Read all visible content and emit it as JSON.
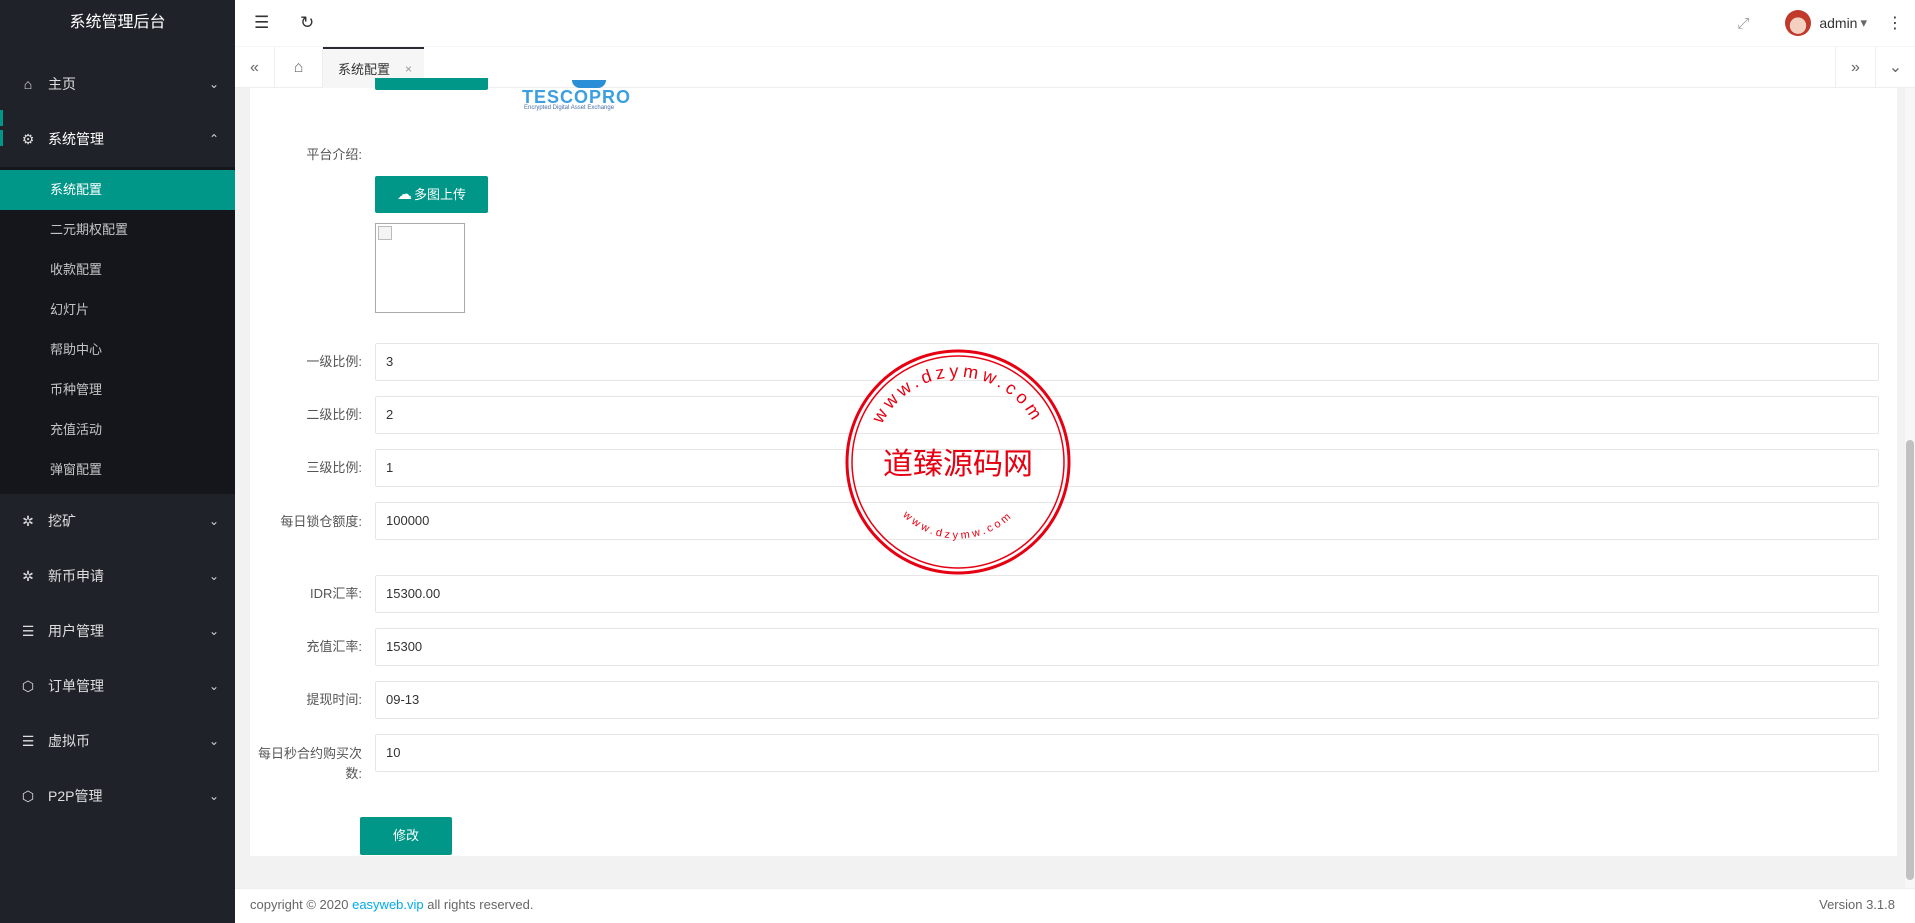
{
  "app_title": "系统管理后台",
  "sidebar": {
    "items": [
      {
        "label": "主页",
        "icon": "home-icon",
        "glyph": "⌂",
        "arrow": "⌄"
      },
      {
        "label": "系统管理",
        "icon": "gear-icon",
        "glyph": "⚙",
        "arrow": "⌃",
        "children": [
          "系统配置",
          "二元期权配置",
          "收款配置",
          "幻灯片",
          "帮助中心",
          "币种管理",
          "充值活动",
          "弹窗配置"
        ]
      },
      {
        "label": "挖矿",
        "icon": "cog-icon",
        "glyph": "✲",
        "arrow": "⌄"
      },
      {
        "label": "新币申请",
        "icon": "cog-icon",
        "glyph": "✲",
        "arrow": "⌄"
      },
      {
        "label": "用户管理",
        "icon": "list-icon",
        "glyph": "☰",
        "arrow": "⌄"
      },
      {
        "label": "订单管理",
        "icon": "cube-icon",
        "glyph": "⬡",
        "arrow": "⌄"
      },
      {
        "label": "虚拟币",
        "icon": "list-icon",
        "glyph": "☰",
        "arrow": "⌄"
      },
      {
        "label": "P2P管理",
        "icon": "cube-icon",
        "glyph": "⬡",
        "arrow": "⌄"
      }
    ]
  },
  "header": {
    "menu_icon": "☰",
    "refresh_icon": "↻",
    "fullscreen_icon": "⤢",
    "user": "admin",
    "caret": "▾",
    "more": "⋮"
  },
  "tabs": {
    "prev": "«",
    "home": "⌂",
    "active_tab": "系统配置",
    "close": "×",
    "next": "»",
    "dropdown": "⌄"
  },
  "form": {
    "logo_text": "TESCOPRO",
    "logo_subtext": "Encrypted Digital Asset Exchange",
    "intro_label": "平台介绍:",
    "upload_button": "多图上传",
    "upload_icon": "☁",
    "fields": [
      {
        "label": "一级比例:",
        "value": "3"
      },
      {
        "label": "二级比例:",
        "value": "2"
      },
      {
        "label": "三级比例:",
        "value": "1"
      },
      {
        "label": "每日锁仓额度:",
        "value": "100000"
      },
      {
        "label": "IDR汇率:",
        "value": "15300.00"
      },
      {
        "label": "充值汇率:",
        "value": "15300"
      },
      {
        "label": "提现时间:",
        "value": "09-13"
      },
      {
        "label": "每日秒合约购买次数:",
        "value": "10"
      }
    ],
    "submit": "修改"
  },
  "watermark": {
    "center_text": "道臻源码网",
    "ring_text_top": "www.dzymw.com",
    "ring_text_bottom": "www.dzymw.com",
    "color": "#e60012"
  },
  "footer": {
    "copyright_prefix": "copyright © 2020 ",
    "link": "easyweb.vip",
    "copyright_suffix": " all rights reserved.",
    "version": "Version 3.1.8"
  },
  "colors": {
    "accent": "#009688",
    "sidebar_bg": "#20222a"
  }
}
